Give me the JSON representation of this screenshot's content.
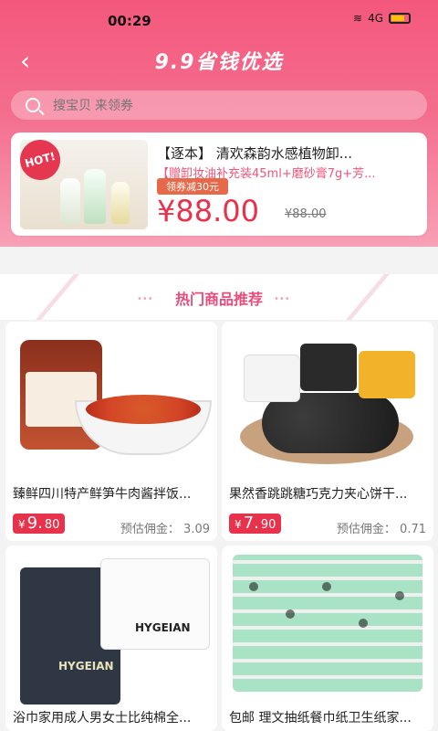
{
  "status_bar": {
    "time": "00:29",
    "signal": "4G",
    "wifi_icon": "wifi-icon",
    "battery_icon": "battery-icon"
  },
  "header": {
    "title": "9.9省钱优选",
    "back_icon": "back-chevron-icon"
  },
  "search": {
    "placeholder": "搜宝贝 来领券",
    "icon": "search-icon"
  },
  "promo": {
    "badge": "HOT!",
    "title": "【逐本】 清欢森韵水感植物卸...",
    "subtitle": "【赠卸妆油补充装45ml+磨砂膏7g+芳...",
    "coupon": "领券减30元",
    "price": "¥88.00",
    "original_price": "¥88.00"
  },
  "section": {
    "title": "热门商品推荐"
  },
  "products": [
    {
      "title": "臻鲜四川特产鲜笋牛肉酱拌饭...",
      "price_int": "9.",
      "price_dec": "80",
      "commission_label": "预估佣金：",
      "commission_value": "3.09"
    },
    {
      "title": "果然香跳跳糖巧克力夹心饼干...",
      "price_int": "7.",
      "price_dec": "90",
      "commission_label": "预估佣金：",
      "commission_value": "0.71"
    },
    {
      "title": "浴巾家用成人男女士比纯棉全...",
      "brand_text_1": "HYGEIAN",
      "brand_text_2": "HYGEIAN"
    },
    {
      "title": "包邮 理文抽纸餐巾纸卫生纸家..."
    }
  ],
  "colors": {
    "header_top": "#f4577c",
    "accent_red": "#e8314b",
    "pink_text": "#e94b7a"
  }
}
